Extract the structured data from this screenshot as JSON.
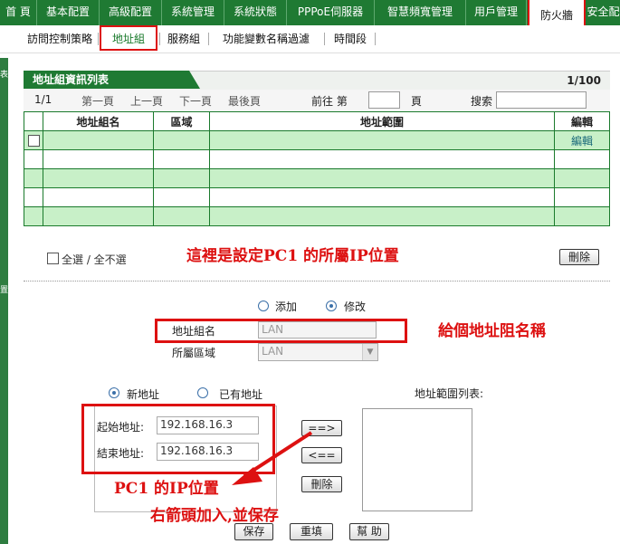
{
  "top_nav": {
    "items": [
      "首 頁",
      "基本配置",
      "高級配置",
      "系統管理",
      "系統狀態",
      "PPPoE伺服器",
      "智慧頻寬管理",
      "用戶管理",
      "防火牆",
      "安全配"
    ],
    "active_index": 8
  },
  "sub_nav": {
    "items": [
      "訪問控制策略",
      "地址組",
      "服務組",
      "功能變數名稱過濾",
      "時間段"
    ],
    "active_index": 1
  },
  "left_strip": {
    "chars": [
      "表",
      "置"
    ]
  },
  "table": {
    "title": "地址組資訊列表",
    "count": "1/100",
    "pager": {
      "page_info": "1/1",
      "first": "第一頁",
      "prev": "上一頁",
      "next": "下一頁",
      "last": "最後頁",
      "goto_prefix": "前往 第",
      "goto_suffix": "頁",
      "search_label": "搜索"
    },
    "columns": [
      "",
      "地址組名",
      "區域",
      "地址範圍",
      "編輯"
    ],
    "rows": [
      {
        "name": "",
        "zone": "",
        "range": "",
        "edit": "編輯"
      }
    ],
    "empty_rows": 4
  },
  "select_all": "全選 / 全不選",
  "delete_button": "刪除",
  "annotations": {
    "note1": "這裡是設定PC1  的所屬IP位置",
    "note2": "給個地址阻名稱",
    "note3": "PC1  的IP位置",
    "note4": "右箭頭加入,並保存"
  },
  "form": {
    "mode_add": "添加",
    "mode_modify": "修改",
    "mode_selected": "modify",
    "group_name_label": "地址組名",
    "group_name_value": "LAN",
    "zone_label": "所屬區域",
    "zone_value": "LAN",
    "new_address": "新地址",
    "existing_address": "已有地址",
    "address_type_selected": "new",
    "start_label": "起始地址:",
    "start_value": "192.168.16.3",
    "end_label": "結束地址:",
    "end_value": "192.168.16.3",
    "range_list_label": "地址範圍列表:",
    "add_arrow": "==>",
    "remove_arrow": "<==",
    "delete": "刪除",
    "save": "保存",
    "reset": "重填",
    "help": "幫 助"
  }
}
